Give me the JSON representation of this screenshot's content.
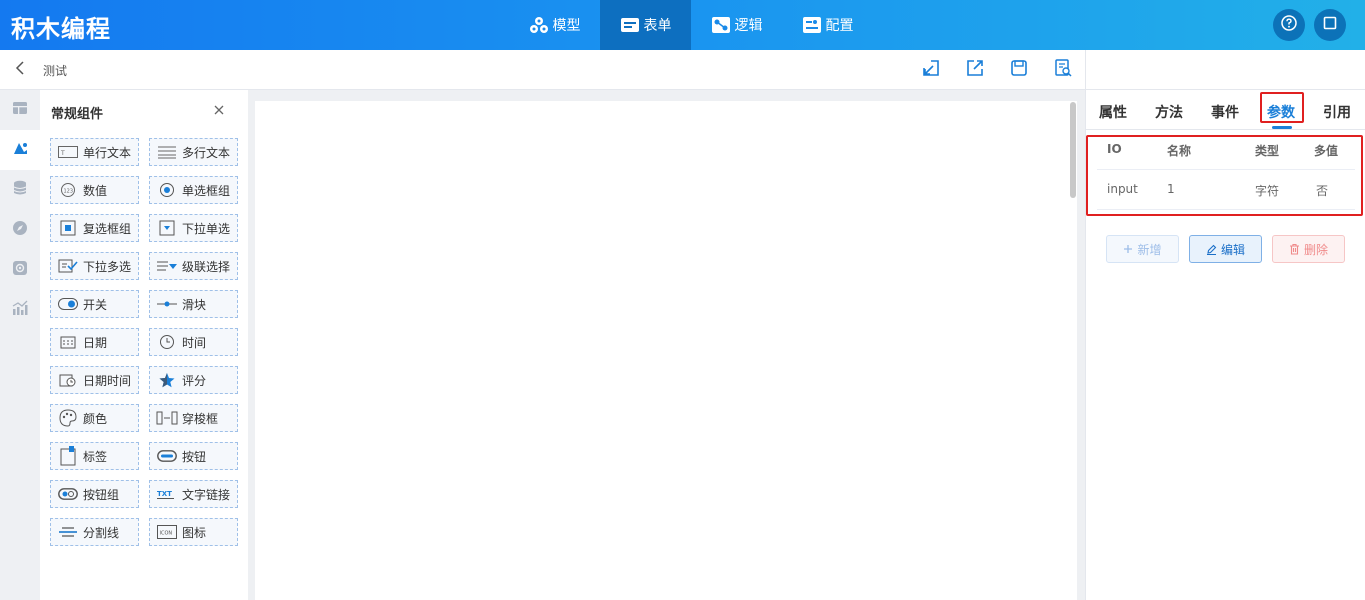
{
  "header": {
    "app_title": "积木编程",
    "nav": [
      {
        "label": "模型",
        "icon": "cubes-icon"
      },
      {
        "label": "表单",
        "icon": "form-icon"
      },
      {
        "label": "逻辑",
        "icon": "logic-icon"
      },
      {
        "label": "配置",
        "icon": "config-icon"
      }
    ],
    "active_nav": "表单",
    "help_icon": "question-circle-icon",
    "fullscreen_icon": "square-icon"
  },
  "toolbar": {
    "page_title": "测试",
    "tools": [
      "import-icon",
      "export-icon",
      "save-icon",
      "preview-icon"
    ]
  },
  "panel": {
    "title": "常规组件",
    "components": [
      {
        "label": "单行文本",
        "icon": "single-line-text-icon"
      },
      {
        "label": "多行文本",
        "icon": "multi-line-text-icon"
      },
      {
        "label": "数值",
        "icon": "number-icon"
      },
      {
        "label": "单选框组",
        "icon": "radio-icon"
      },
      {
        "label": "复选框组",
        "icon": "checkbox-icon"
      },
      {
        "label": "下拉单选",
        "icon": "dropdown-icon"
      },
      {
        "label": "下拉多选",
        "icon": "multi-dropdown-icon"
      },
      {
        "label": "级联选择",
        "icon": "cascader-icon"
      },
      {
        "label": "开关",
        "icon": "switch-icon"
      },
      {
        "label": "滑块",
        "icon": "slider-icon"
      },
      {
        "label": "日期",
        "icon": "calendar-icon"
      },
      {
        "label": "时间",
        "icon": "clock-icon"
      },
      {
        "label": "日期时间",
        "icon": "datetime-icon"
      },
      {
        "label": "评分",
        "icon": "star-icon"
      },
      {
        "label": "颜色",
        "icon": "palette-icon"
      },
      {
        "label": "穿梭框",
        "icon": "transfer-icon"
      },
      {
        "label": "标签",
        "icon": "label-icon"
      },
      {
        "label": "按钮",
        "icon": "button-icon"
      },
      {
        "label": "按钮组",
        "icon": "button-group-icon"
      },
      {
        "label": "文字链接",
        "icon": "text-link-icon"
      },
      {
        "label": "分割线",
        "icon": "divider-icon"
      },
      {
        "label": "图标",
        "icon": "icon-icon"
      }
    ]
  },
  "props": {
    "tabs": [
      "属性",
      "方法",
      "事件",
      "参数",
      "引用"
    ],
    "active_tab": "参数",
    "table": {
      "headers": [
        "IO",
        "名称",
        "类型",
        "多值"
      ],
      "rows": [
        [
          "input",
          "1",
          "字符",
          "否"
        ]
      ]
    },
    "buttons": {
      "add": "新增",
      "edit": "编辑",
      "delete": "删除"
    }
  },
  "colors": {
    "header_gradient_start": "#1479f0",
    "header_gradient_end": "#22b0e8",
    "accent": "#1a7fd8",
    "highlight": "#e02020"
  }
}
